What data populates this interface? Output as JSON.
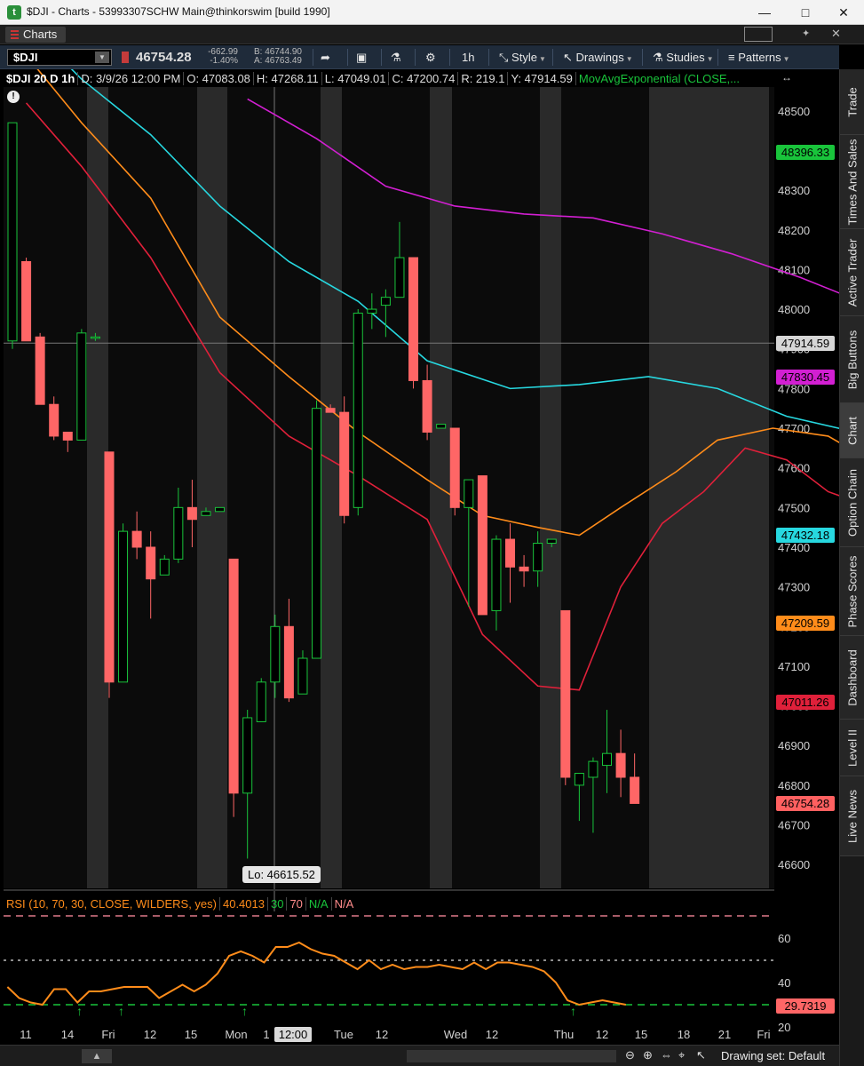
{
  "window": {
    "title": "$DJI - Charts - 53993307SCHW Main@thinkorswim [build 1990]",
    "minimize_icon": "minimize-icon",
    "maximize_icon": "maximize-icon",
    "close_icon": "close-icon"
  },
  "tabbar": {
    "tab_label": "Charts"
  },
  "toolbar": {
    "symbol": "$DJI",
    "last_price": "46754.28",
    "change": "-662.99",
    "change_pct": "-1.40%",
    "bid": "B: 46744.90",
    "ask": "A: 46763.49",
    "timeframe": "1h",
    "style_label": "Style",
    "drawings_label": "Drawings",
    "studies_label": "Studies",
    "patterns_label": "Patterns"
  },
  "infobar": {
    "symbol_period": "$DJI 20 D 1h",
    "date": "D: 3/9/26 12:00 PM",
    "open": "O: 47083.08",
    "high": "H: 47268.11",
    "low": "L: 47049.01",
    "close": "C: 47200.74",
    "range": "R: 219.1",
    "y": "Y: 47914.59",
    "ema_study": "MovAvgExponential (CLOSE,..."
  },
  "price_axis": {
    "ticks": [
      "48500",
      "48400",
      "48300",
      "48200",
      "48100",
      "48000",
      "47900",
      "47800",
      "47700",
      "47600",
      "47500",
      "47400",
      "47300",
      "47200",
      "47100",
      "47000",
      "46900",
      "46800",
      "46700",
      "46600"
    ],
    "labels": [
      {
        "text": "48396.33",
        "color": "#19c43b",
        "value": 48396.33
      },
      {
        "text": "47914.59",
        "color": "#d6d6d6",
        "value": 47914.59
      },
      {
        "text": "47830.45",
        "color": "#d21fd2",
        "value": 47830.45
      },
      {
        "text": "47432.18",
        "color": "#27d8e0",
        "value": 47432.18
      },
      {
        "text": "47209.59",
        "color": "#ff8c1a",
        "value": 47209.59
      },
      {
        "text": "47011.26",
        "color": "#e0203a",
        "value": 47011.26
      },
      {
        "text": "46754.28",
        "color": "#ff6060",
        "value": 46754.28
      }
    ]
  },
  "lo_label": "Lo: 46615.52",
  "rsi": {
    "params": "RSI (10, 70, 30, CLOSE, WILDERS, yes)",
    "value": "40.4013",
    "oversold": "30",
    "overbought": "70",
    "na1": "N/A",
    "na2": "N/A",
    "ticks": [
      "60",
      "40",
      "20"
    ],
    "current_label": "29.7319"
  },
  "time_axis": {
    "labels": [
      "11",
      "14",
      "Fri",
      "12",
      "15",
      "Mon",
      "1",
      "Tue",
      "12",
      "Wed",
      "12",
      "Thu",
      "12",
      "15",
      "18",
      "21",
      "Fri"
    ],
    "crosshair": "12:00"
  },
  "chart_data": {
    "type": "candlestick",
    "symbol": "$DJI",
    "interval": "1h",
    "ylim": [
      46540,
      48560
    ],
    "candles": [
      {
        "o": 47920,
        "h": 48470,
        "l": 47900,
        "c": 48470
      },
      {
        "o": 48120,
        "h": 48130,
        "l": 47920,
        "c": 47920
      },
      {
        "o": 47930,
        "h": 47940,
        "l": 47760,
        "c": 47760
      },
      {
        "o": 47760,
        "h": 47780,
        "l": 47670,
        "c": 47680
      },
      {
        "o": 47690,
        "h": 47690,
        "l": 47640,
        "c": 47670
      },
      {
        "o": 47670,
        "h": 47950,
        "l": 47670,
        "c": 47940
      },
      {
        "o": 47930,
        "h": 47940,
        "l": 47920,
        "c": 47930
      },
      {
        "o": 47640,
        "h": 47640,
        "l": 47020,
        "c": 47060
      },
      {
        "o": 47060,
        "h": 47460,
        "l": 47060,
        "c": 47440
      },
      {
        "o": 47440,
        "h": 47490,
        "l": 47370,
        "c": 47400
      },
      {
        "o": 47400,
        "h": 47440,
        "l": 47220,
        "c": 47320
      },
      {
        "o": 47330,
        "h": 47380,
        "l": 47330,
        "c": 47370
      },
      {
        "o": 47370,
        "h": 47550,
        "l": 47360,
        "c": 47500
      },
      {
        "o": 47500,
        "h": 47570,
        "l": 47400,
        "c": 47470
      },
      {
        "o": 47480,
        "h": 47500,
        "l": 47480,
        "c": 47490
      },
      {
        "o": 47490,
        "h": 47500,
        "l": 47490,
        "c": 47500
      },
      {
        "o": 47370,
        "h": 47370,
        "l": 46720,
        "c": 46780
      },
      {
        "o": 46780,
        "h": 46990,
        "l": 46615,
        "c": 46970
      },
      {
        "o": 46960,
        "h": 47070,
        "l": 46960,
        "c": 47060
      },
      {
        "o": 47060,
        "h": 47230,
        "l": 47020,
        "c": 47200
      },
      {
        "o": 47200,
        "h": 47270,
        "l": 47010,
        "c": 47020
      },
      {
        "o": 47030,
        "h": 47140,
        "l": 47030,
        "c": 47120
      },
      {
        "o": 47120,
        "h": 47770,
        "l": 47120,
        "c": 47750
      },
      {
        "o": 47750,
        "h": 47760,
        "l": 47740,
        "c": 47740
      },
      {
        "o": 47740,
        "h": 47780,
        "l": 47460,
        "c": 47480
      },
      {
        "o": 47500,
        "h": 48000,
        "l": 47480,
        "c": 47990
      },
      {
        "o": 47990,
        "h": 48040,
        "l": 47950,
        "c": 48000
      },
      {
        "o": 48010,
        "h": 48050,
        "l": 47930,
        "c": 48030
      },
      {
        "o": 48030,
        "h": 48220,
        "l": 48030,
        "c": 48130
      },
      {
        "o": 48130,
        "h": 48130,
        "l": 47800,
        "c": 47820
      },
      {
        "o": 47820,
        "h": 47860,
        "l": 47670,
        "c": 47690
      },
      {
        "o": 47700,
        "h": 47710,
        "l": 47700,
        "c": 47710
      },
      {
        "o": 47700,
        "h": 47700,
        "l": 47480,
        "c": 47500
      },
      {
        "o": 47500,
        "h": 47550,
        "l": 47250,
        "c": 47570
      },
      {
        "o": 47580,
        "h": 47580,
        "l": 47230,
        "c": 47230
      },
      {
        "o": 47240,
        "h": 47430,
        "l": 47190,
        "c": 47420
      },
      {
        "o": 47420,
        "h": 47460,
        "l": 47260,
        "c": 47350
      },
      {
        "o": 47350,
        "h": 47380,
        "l": 47300,
        "c": 47340
      },
      {
        "o": 47340,
        "h": 47440,
        "l": 47300,
        "c": 47410
      },
      {
        "o": 47410,
        "h": 47420,
        "l": 47400,
        "c": 47420
      },
      {
        "o": 47240,
        "h": 47240,
        "l": 46800,
        "c": 46820
      },
      {
        "o": 46800,
        "h": 46830,
        "l": 46710,
        "c": 46830
      },
      {
        "o": 46820,
        "h": 46870,
        "l": 46680,
        "c": 46860
      },
      {
        "o": 46850,
        "h": 46990,
        "l": 46780,
        "c": 46880
      },
      {
        "o": 46880,
        "h": 46940,
        "l": 46770,
        "c": 46820
      },
      {
        "o": 46820,
        "h": 46880,
        "l": 46760,
        "c": 46754
      }
    ],
    "ema_series": [
      {
        "name": "",
        "color": "#19c43b",
        "points": [
          [
            61,
            48615
          ],
          [
            65,
            48560
          ],
          [
            70,
            48520
          ],
          [
            75,
            48470
          ],
          [
            80,
            48400
          ]
        ]
      },
      {
        "name": "",
        "color": "#d21fd2",
        "points": [
          [
            17,
            48530
          ],
          [
            22,
            48430
          ],
          [
            27,
            48310
          ],
          [
            32,
            48260
          ],
          [
            37,
            48240
          ],
          [
            42,
            48230
          ],
          [
            47,
            48190
          ],
          [
            52,
            48140
          ],
          [
            57,
            48080
          ],
          [
            62,
            48010
          ],
          [
            67,
            47980
          ],
          [
            72,
            47910
          ],
          [
            80,
            47830
          ]
        ]
      },
      {
        "name": "",
        "color": "#27d8e0",
        "points": [
          [
            1,
            48720
          ],
          [
            5,
            48580
          ],
          [
            10,
            48440
          ],
          [
            15,
            48260
          ],
          [
            20,
            48120
          ],
          [
            25,
            48020
          ],
          [
            30,
            47870
          ],
          [
            36,
            47800
          ],
          [
            41,
            47810
          ],
          [
            46,
            47830
          ],
          [
            51,
            47800
          ],
          [
            56,
            47730
          ],
          [
            61,
            47690
          ],
          [
            66,
            47640
          ],
          [
            70,
            47580
          ],
          [
            75,
            47520
          ],
          [
            80,
            47430
          ]
        ]
      },
      {
        "name": "",
        "color": "#ff8c1a",
        "points": [
          [
            1,
            48640
          ],
          [
            5,
            48470
          ],
          [
            10,
            48280
          ],
          [
            15,
            47980
          ],
          [
            20,
            47830
          ],
          [
            25,
            47690
          ],
          [
            30,
            47570
          ],
          [
            34,
            47480
          ],
          [
            38,
            47450
          ],
          [
            41,
            47430
          ],
          [
            44,
            47500
          ],
          [
            48,
            47590
          ],
          [
            51,
            47670
          ],
          [
            55,
            47700
          ],
          [
            59,
            47680
          ],
          [
            63,
            47600
          ],
          [
            68,
            47520
          ],
          [
            72,
            47450
          ],
          [
            76,
            47340
          ],
          [
            80,
            47210
          ]
        ]
      },
      {
        "name": "",
        "color": "#e0203a",
        "points": [
          [
            1,
            48520
          ],
          [
            5,
            48360
          ],
          [
            10,
            48130
          ],
          [
            15,
            47840
          ],
          [
            20,
            47680
          ],
          [
            25,
            47580
          ],
          [
            30,
            47470
          ],
          [
            34,
            47180
          ],
          [
            38,
            47050
          ],
          [
            41,
            47040
          ],
          [
            44,
            47300
          ],
          [
            47,
            47460
          ],
          [
            50,
            47540
          ],
          [
            53,
            47650
          ],
          [
            56,
            47620
          ],
          [
            59,
            47540
          ],
          [
            63,
            47490
          ],
          [
            67,
            47470
          ],
          [
            70,
            47420
          ],
          [
            75,
            47180
          ],
          [
            80,
            47011
          ]
        ]
      }
    ],
    "current_price": 46754.28,
    "crosshair_y": 47914.59,
    "rsi_line": {
      "ylim": [
        20,
        72
      ],
      "upper": 70,
      "lower": 30,
      "mid": 50,
      "values": [
        [
          1,
          38
        ],
        [
          4,
          33
        ],
        [
          7,
          31
        ],
        [
          10,
          30
        ],
        [
          13,
          37
        ],
        [
          16,
          37
        ],
        [
          19,
          31
        ],
        [
          22,
          36
        ],
        [
          25,
          36
        ],
        [
          28,
          37
        ],
        [
          31,
          38
        ],
        [
          34,
          38
        ],
        [
          37,
          38
        ],
        [
          40,
          33
        ],
        [
          43,
          36
        ],
        [
          46,
          39
        ],
        [
          49,
          36
        ],
        [
          52,
          39
        ],
        [
          55,
          44
        ],
        [
          58,
          52
        ],
        [
          61,
          54
        ],
        [
          64,
          52
        ],
        [
          67,
          49
        ],
        [
          70,
          56
        ],
        [
          73,
          56
        ],
        [
          76,
          58
        ],
        [
          79,
          55
        ],
        [
          82,
          53
        ],
        [
          85,
          52
        ],
        [
          88,
          49
        ],
        [
          91,
          46
        ],
        [
          94,
          50
        ],
        [
          97,
          46
        ],
        [
          100,
          48
        ],
        [
          103,
          46
        ],
        [
          106,
          47
        ],
        [
          109,
          47
        ],
        [
          112,
          48
        ],
        [
          115,
          47
        ],
        [
          118,
          46
        ],
        [
          121,
          49
        ],
        [
          124,
          46
        ],
        [
          127,
          49
        ],
        [
          130,
          49
        ],
        [
          133,
          48
        ],
        [
          136,
          47
        ],
        [
          139,
          45
        ],
        [
          142,
          40
        ],
        [
          145,
          32
        ],
        [
          148,
          30
        ],
        [
          151,
          31
        ],
        [
          154,
          32
        ],
        [
          157,
          31
        ],
        [
          160,
          30
        ]
      ],
      "value": 29.7319
    }
  },
  "statusbar": {
    "drawing_set": "Drawing set: Default"
  },
  "sidetabs": [
    "Trade",
    "Times And Sales",
    "Active Trader",
    "Big Buttons",
    "Chart",
    "Option Chain",
    "Phase Scores",
    "Dashboard",
    "Level II",
    "Live News"
  ]
}
